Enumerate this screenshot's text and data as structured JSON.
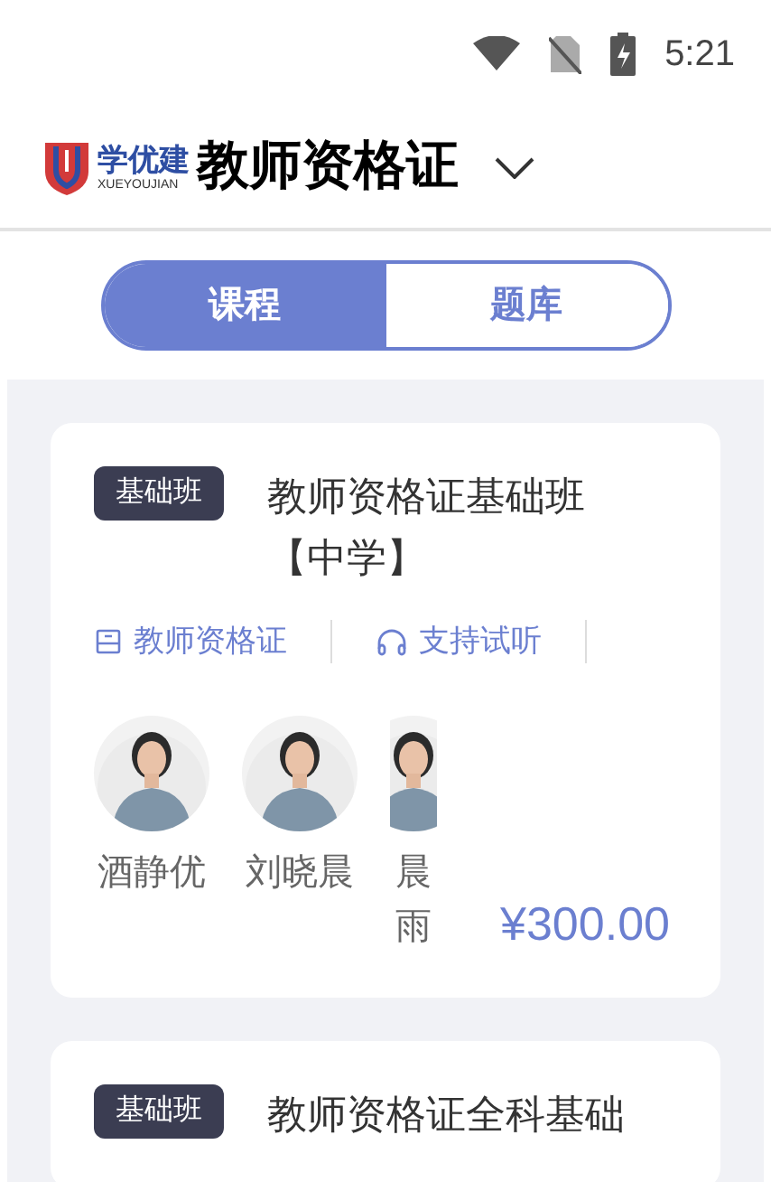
{
  "status_bar": {
    "time": "5:21"
  },
  "header": {
    "logo": {
      "name": "学优建",
      "subtitle": "XUEYOUJIAN"
    },
    "title": "教师资格证"
  },
  "tabs": [
    {
      "label": "课程",
      "selected": true
    },
    {
      "label": "题库",
      "selected": false
    }
  ],
  "courses": [
    {
      "tag": "基础班",
      "title": "教师资格证基础班【中学】",
      "meta": [
        {
          "kind": "book",
          "label": "教师资格证"
        },
        {
          "kind": "audio",
          "label": "支持试听"
        }
      ],
      "teachers": [
        {
          "name": "酒静优"
        },
        {
          "name": "刘晓晨"
        },
        {
          "name": "晨雨"
        }
      ],
      "price": "¥300.00"
    },
    {
      "tag": "基础班",
      "title": "教师资格证全科基础"
    }
  ]
}
